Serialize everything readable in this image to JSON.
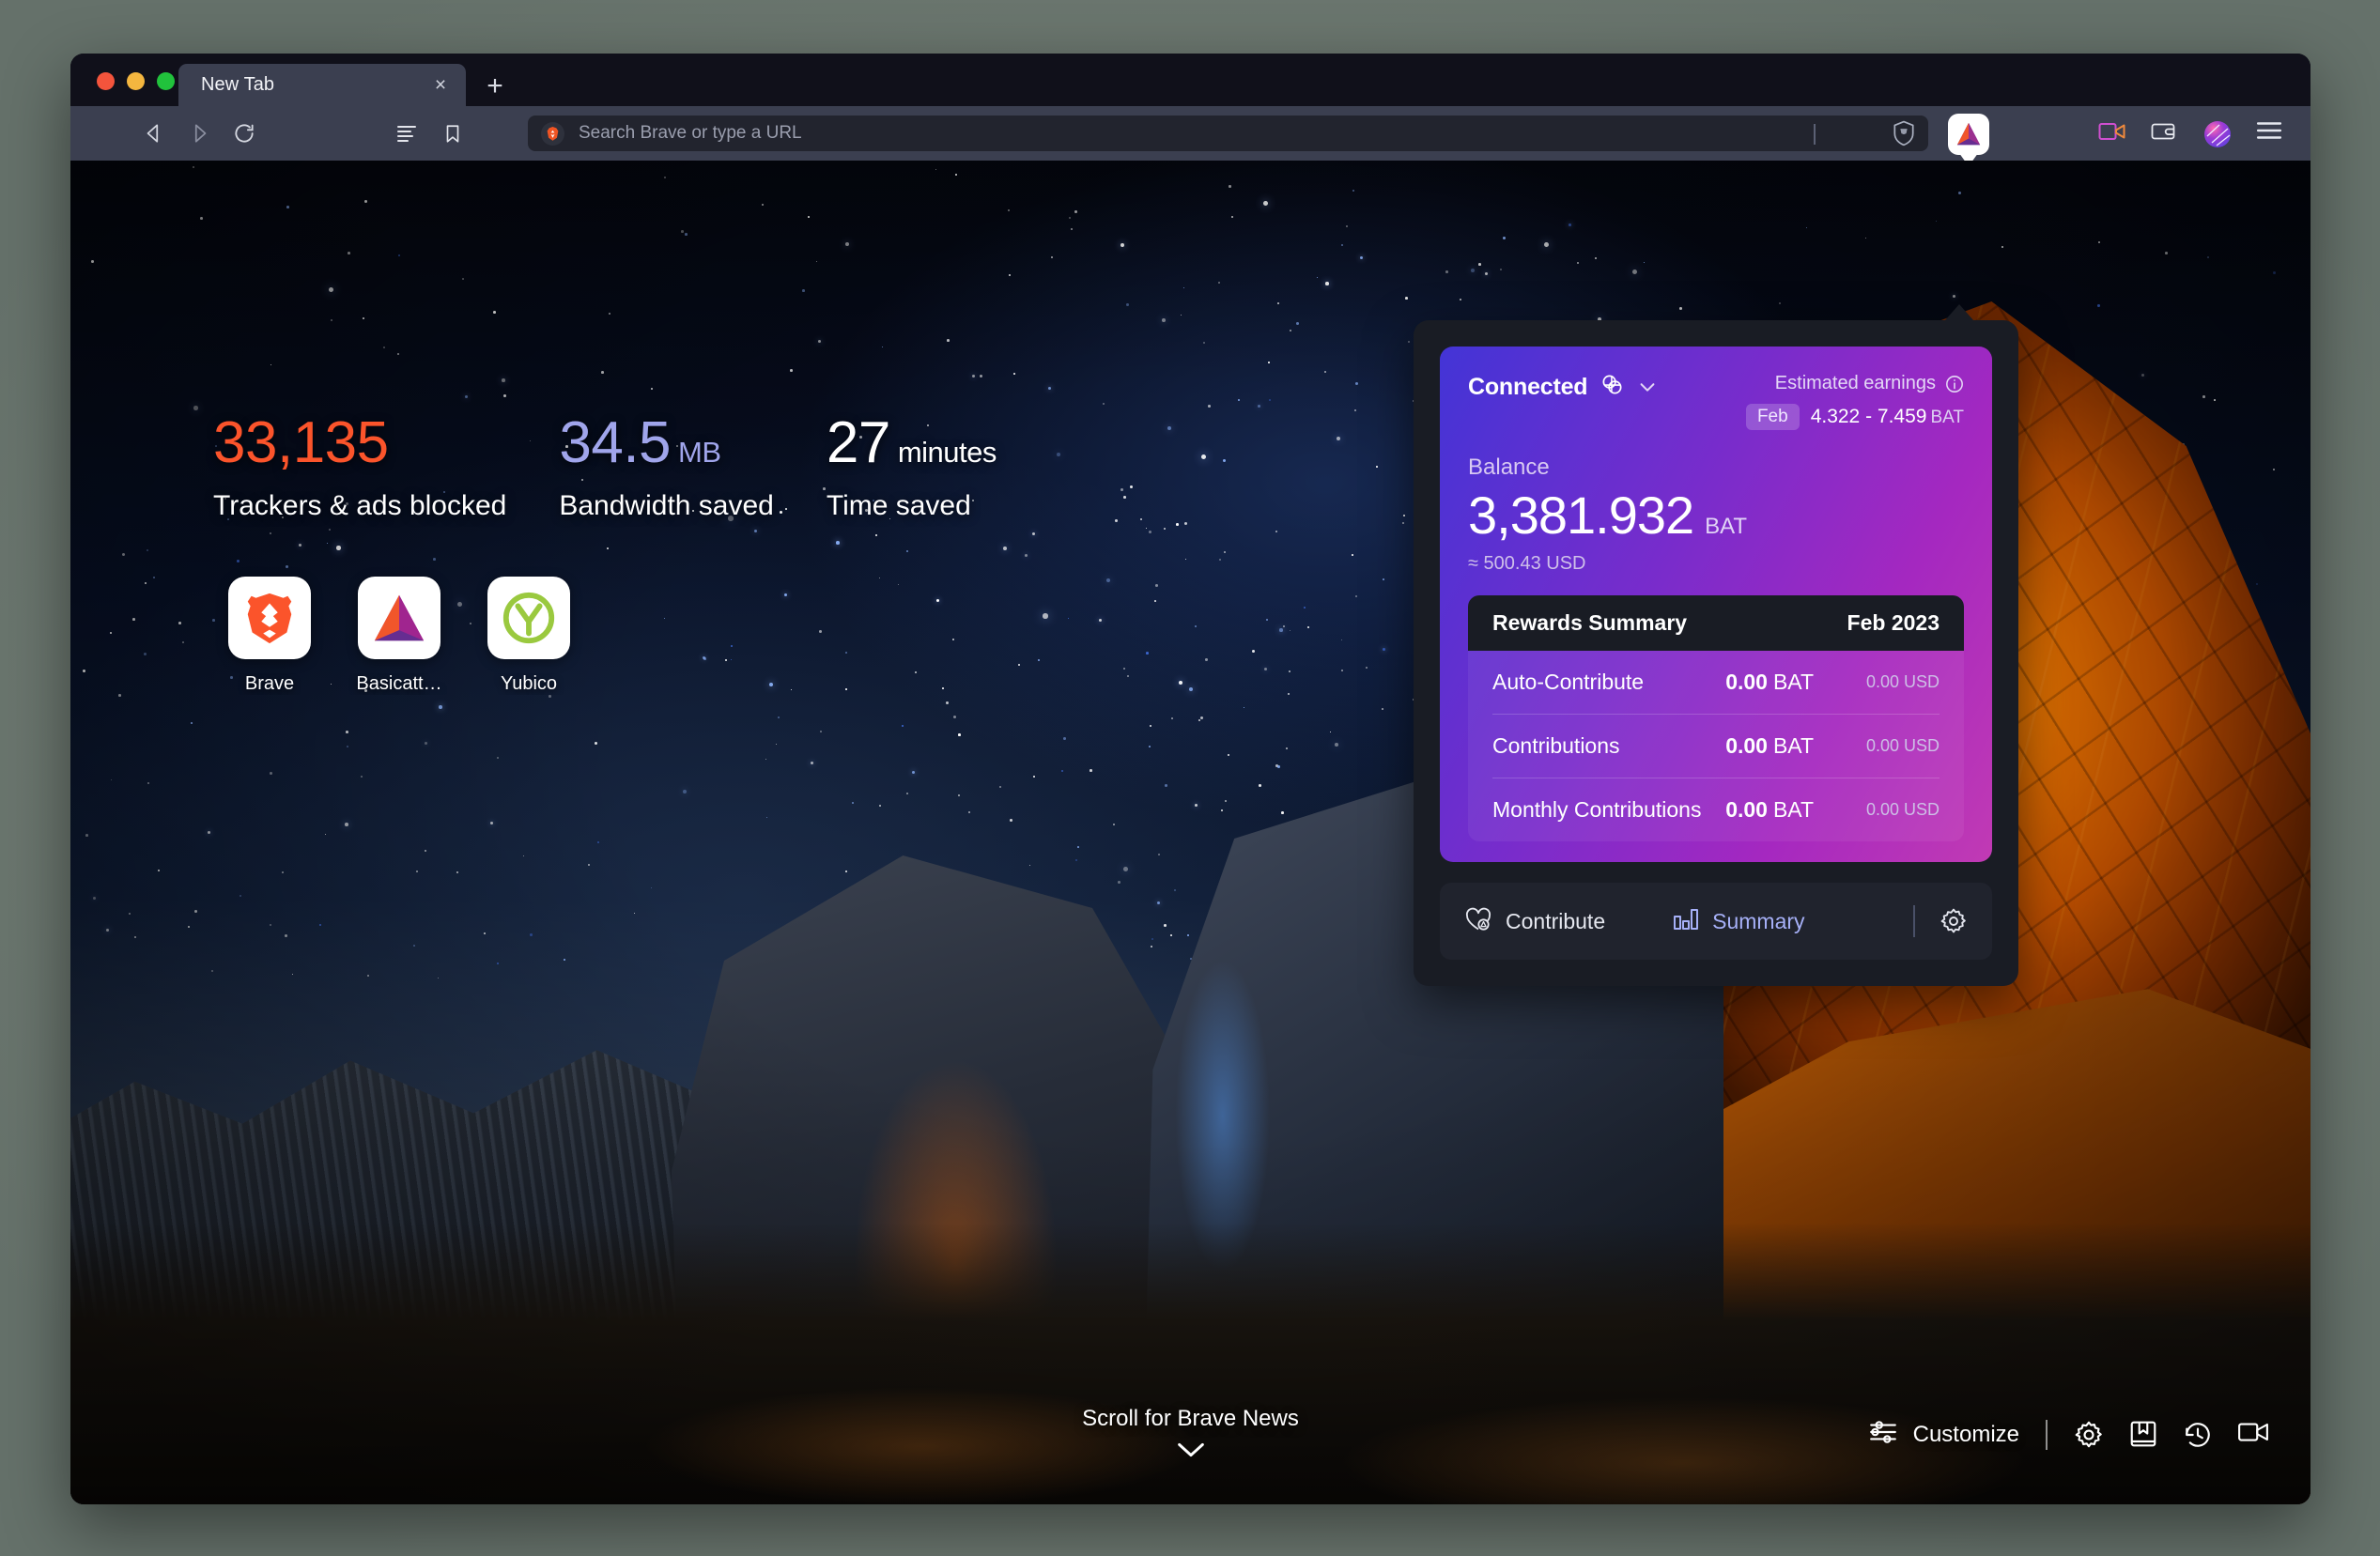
{
  "window": {
    "traffic_lights": [
      "close",
      "minimize",
      "maximize"
    ],
    "tab": {
      "title": "New Tab",
      "close_label": "×"
    },
    "new_tab_button": "+"
  },
  "toolbar": {
    "back_icon": "back-arrow-icon",
    "forward_icon": "forward-arrow-icon",
    "reload_icon": "reload-icon",
    "reading_list_icon": "reading-list-icon",
    "bookmark_icon": "bookmark-icon",
    "omnibox_placeholder": "Search Brave or type a URL",
    "shields_icon": "brave-shields-icon",
    "bat_icon": "bat-rewards-icon",
    "right_icons": [
      "video-call-icon",
      "wallet-icon",
      "brave-talk-icon",
      "menu-icon"
    ]
  },
  "stats": [
    {
      "value": "33,135",
      "unit": "",
      "label": "Trackers & ads blocked",
      "color": "#fb542b"
    },
    {
      "value": "34.5",
      "unit": "MB",
      "label": "Bandwidth saved",
      "color": "#a0a5eb"
    },
    {
      "value": "27",
      "unit": "minutes",
      "label": "Time saved",
      "color": "#ffffff"
    }
  ],
  "top_sites": [
    {
      "label": "Brave",
      "icon": "brave-lion-icon"
    },
    {
      "label": "Basicatt…",
      "icon": "bat-triangle-icon"
    },
    {
      "label": "Yubico",
      "icon": "yubico-y-icon"
    }
  ],
  "rewards": {
    "connected_label": "Connected",
    "connected_provider_icon": "uphold-link-icon",
    "chevron_icon": "chevron-down-icon",
    "estimated_earnings_label": "Estimated earnings",
    "info_icon": "info-icon",
    "earnings_month": "Feb",
    "earnings_range": "4.322 - 7.459",
    "earnings_currency": "BAT",
    "balance_label": "Balance",
    "balance_amount": "3,381.932",
    "balance_unit": "BAT",
    "balance_usd": "≈ 500.43 USD",
    "summary_title": "Rewards Summary",
    "summary_month": "Feb 2023",
    "summary_rows": [
      {
        "name": "Auto-Contribute",
        "bat": "0.00",
        "bat_unit": "BAT",
        "usd": "0.00 USD"
      },
      {
        "name": "Contributions",
        "bat": "0.00",
        "bat_unit": "BAT",
        "usd": "0.00 USD"
      },
      {
        "name": "Monthly Contributions",
        "bat": "0.00",
        "bat_unit": "BAT",
        "usd": "0.00 USD"
      }
    ],
    "actions": {
      "contribute_label": "Contribute",
      "contribute_icon": "heart-bat-icon",
      "summary_label": "Summary",
      "summary_icon": "bar-chart-icon",
      "settings_icon": "gear-icon"
    },
    "accent_gradient_start": "#4334d6",
    "accent_gradient_end": "#c13ab4"
  },
  "footer": {
    "scroll_hint": "Scroll for Brave News",
    "scroll_chevron_icon": "chevron-down-icon",
    "customize_label": "Customize",
    "customize_icon": "sliders-icon",
    "icons": [
      "gear-icon",
      "bookmarks-book-icon",
      "history-clock-icon",
      "brave-talk-video-icon"
    ]
  }
}
